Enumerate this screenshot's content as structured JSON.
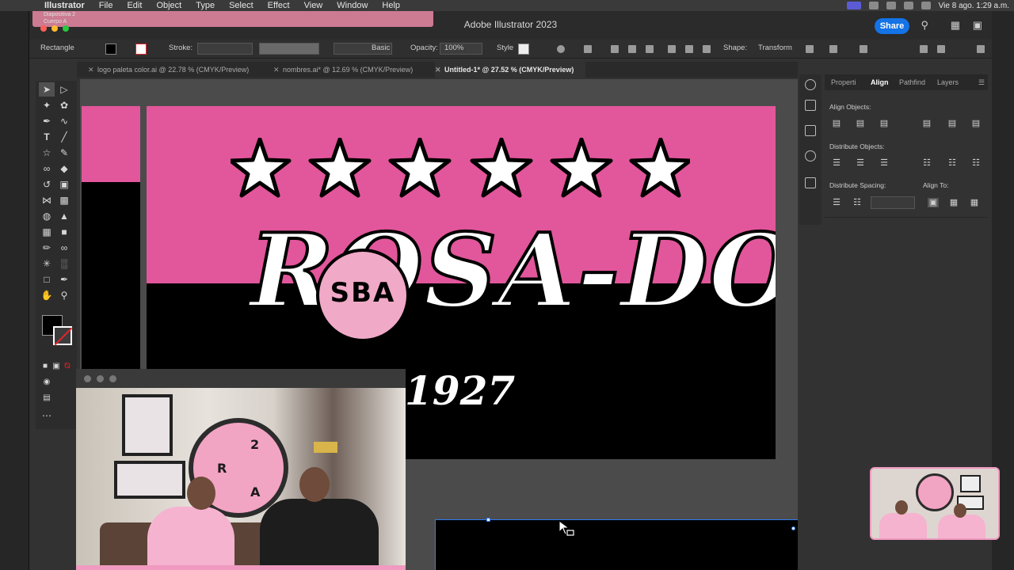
{
  "menubar": {
    "app": "Illustrator",
    "items": [
      "File",
      "Edit",
      "Object",
      "Type",
      "Select",
      "Effect",
      "View",
      "Window",
      "Help"
    ],
    "clock": "Vie 8 ago. 1:29 a.m."
  },
  "window": {
    "title": "Adobe Illustrator 2023",
    "slide_overlay": [
      "Diapositiva 2",
      "Cuerpo A"
    ],
    "share_label": "Share"
  },
  "control_bar": {
    "object_type": "Rectangle",
    "stroke_label": "Stroke:",
    "brush_label": "Basic",
    "opacity_label": "Opacity:",
    "opacity_value": "100%",
    "style_label": "Style",
    "shape_label": "Shape:",
    "transform_label": "Transform"
  },
  "doc_tabs": [
    {
      "label": "logo paleta color.ai @ 22.78 % (CMYK/Preview)",
      "active": false
    },
    {
      "label": "nombres.ai* @ 12.69 % (CMYK/Preview)",
      "active": false
    },
    {
      "label": "Untitled-1* @ 27.52 % (CMYK/Preview)",
      "active": true
    }
  ],
  "artwork": {
    "logo_text": "ROSA-DOS",
    "badge_text": "SBA",
    "year": "1927",
    "pink": "#e2569b",
    "badge_pink": "#f0a9c6"
  },
  "panel": {
    "tabs": [
      "Properti",
      "Align",
      "Pathfind",
      "Layers"
    ],
    "active_tab": "Align",
    "align_objects": "Align Objects:",
    "distribute_objects": "Distribute Objects:",
    "distribute_spacing": "Distribute Spacing:",
    "align_to": "Align To:"
  },
  "webcam": {
    "wheel_letters": [
      "2",
      "R",
      "A"
    ]
  }
}
